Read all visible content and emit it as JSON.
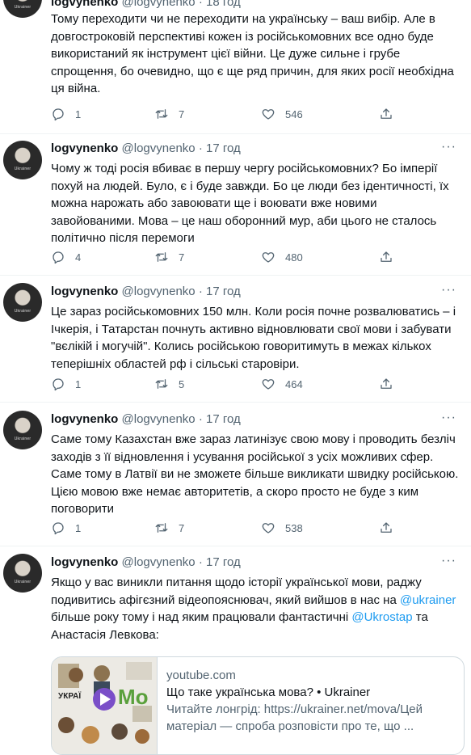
{
  "tweets": [
    {
      "name": "logvynenko",
      "handle": "@logvynenko",
      "time": "18 год",
      "text": "Тому переходити чи не переходити на українську – ваш вибір. Але в довгостроковій перспективі кожен із російськомовних все одно буде використаний як інструмент цієї війни. Це дуже сильне і грубе спрощення, бо очевидно, що є ще ряд причин, для яких росії необхідна ця війна.",
      "replies": "1",
      "retweets": "7",
      "likes": "546"
    },
    {
      "name": "logvynenko",
      "handle": "@logvynenko",
      "time": "17 год",
      "text": "Чому ж тоді росія вбиває в першу чергу російськомовних? Бо імперії похуй на людей. Було, є і буде завжди. Бо це люди без ідентичності, їх можна нарожать або завоювати ще і воювати вже новими завойованими. Мова – це наш оборонний мур, аби цього не сталось політично після перемоги",
      "replies": "4",
      "retweets": "7",
      "likes": "480"
    },
    {
      "name": "logvynenko",
      "handle": "@logvynenko",
      "time": "17 год",
      "text": "Це зараз російськомовних 150 млн. Коли росія почне розвалюватись – і Ічкерія, і Татарстан почнуть активно відновлювати свої мови і забувати \"вєлікій і могучій\". Колись російською говоритимуть в межах кількох теперішніх областей рф і сільські старовіри.",
      "replies": "1",
      "retweets": "5",
      "likes": "464"
    },
    {
      "name": "logvynenko",
      "handle": "@logvynenko",
      "time": "17 год",
      "text": "Саме тому Казахстан вже зараз латинізує свою мову і проводить безліч заходів з її відновлення і усування російської з усіх можливих сфер. Саме тому в Латвії ви не зможете більше викликати швидку російською. Цією мовою вже немає авторитетів, а скоро просто не буде з ким поговорити",
      "replies": "1",
      "retweets": "7",
      "likes": "538"
    },
    {
      "name": "logvynenko",
      "handle": "@logvynenko",
      "time": "17 год",
      "text_part1": "Якщо у вас виникли питання щодо історії української мови, раджу подивитись афігєзний відеопояснювач, який вийшов в нас на",
      "mention1": "@ukrainer",
      "text_part2": "більше року тому і над яким працювали фантастичні",
      "mention2": "@Ukrostap",
      "text_part3": "та Анастасія Левкова:"
    }
  ],
  "avatar_text": "Ukrainer",
  "dot": "·",
  "more": "···",
  "card": {
    "domain": "youtube.com",
    "title": "Що таке українська мова? • Ukrainer",
    "description": "Читайте лонгрід: https://ukrainer.net/mova/Цей матеріал — спроба розповісти про те, що ...",
    "thumb_text1": "УКРАЇ",
    "thumb_text2": "Мо"
  },
  "colors": {
    "accent": "#1d9bf0",
    "text": "#0f1419",
    "muted": "#536471",
    "border": "#cfd9de"
  }
}
